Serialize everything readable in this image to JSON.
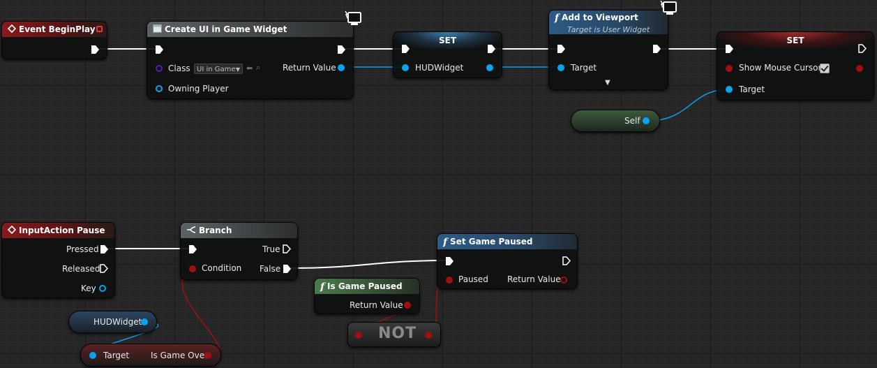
{
  "nodes": {
    "event_beginplay": {
      "title": "Event BeginPlay"
    },
    "create_widget": {
      "title": "Create UI in Game Widget",
      "class_label": "Class",
      "class_value": "UI in Game",
      "owning_player_label": "Owning Player",
      "return_label": "Return Value"
    },
    "set_hud": {
      "title": "SET",
      "var_label": "HUDWidget"
    },
    "add_viewport": {
      "title": "Add to Viewport",
      "subtitle": "Target is User Widget",
      "target_label": "Target"
    },
    "set_cursor": {
      "title": "SET",
      "show_label": "Show Mouse Cursor",
      "target_label": "Target"
    },
    "self_node": {
      "label": "Self"
    },
    "input_pause": {
      "title": "InputAction Pause",
      "pressed_label": "Pressed",
      "released_label": "Released",
      "key_label": "Key"
    },
    "branch": {
      "title": "Branch",
      "condition_label": "Condition",
      "true_label": "True",
      "false_label": "False"
    },
    "set_game_paused": {
      "title": "Set Game Paused",
      "paused_label": "Paused",
      "return_label": "Return Value"
    },
    "is_game_paused": {
      "title": "Is Game Paused",
      "return_label": "Return Value"
    },
    "not_node": {
      "label": "NOT"
    },
    "hud_getter": {
      "label": "HUDWidget"
    },
    "is_game_over": {
      "target_label": "Target",
      "output_label": "Is Game Over"
    }
  },
  "colors": {
    "exec": "#ffffff",
    "object_pin": "#0aa3f0",
    "bool_pin": "#a01010",
    "class_pin": "#5a1bbd",
    "event_header": "#8a1a1e",
    "function_header": "#2d5b86",
    "pure_header": "#4b7a4b"
  },
  "show_mouse_cursor_checked": true
}
